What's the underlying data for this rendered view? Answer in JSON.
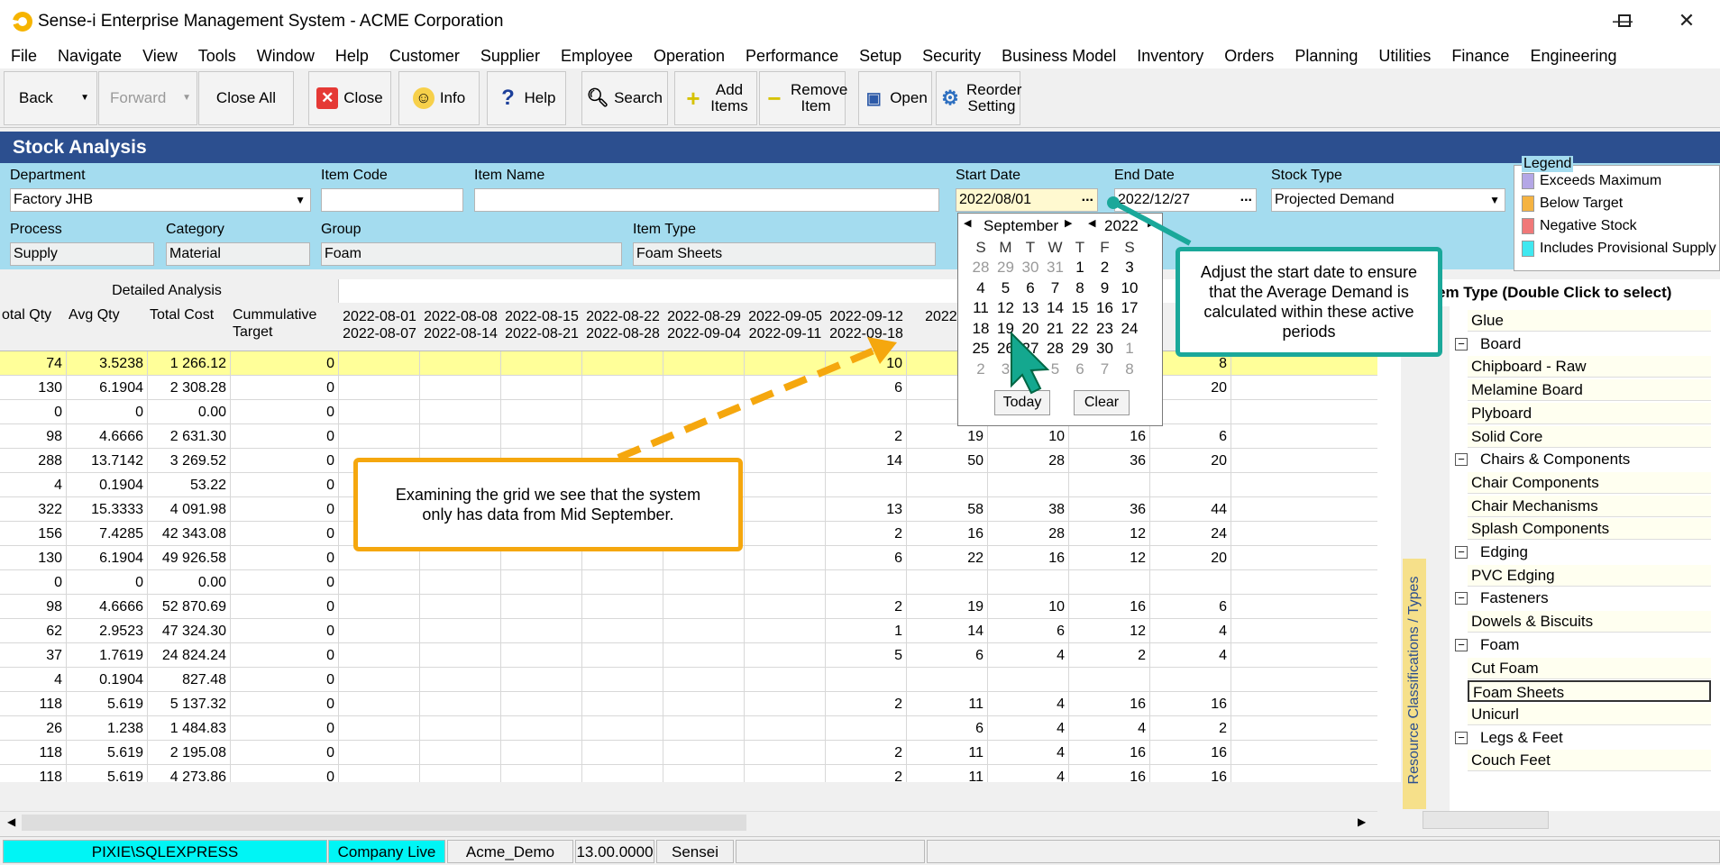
{
  "window": {
    "title": "Sense-i Enterprise Management System - ACME Corporation",
    "min": "—",
    "max": "☐",
    "close": "✕"
  },
  "menu": [
    "File",
    "Navigate",
    "View",
    "Tools",
    "Window",
    "Help",
    "Customer",
    "Supplier",
    "Employee",
    "Operation",
    "Performance",
    "Setup",
    "Security",
    "Business Model",
    "Inventory",
    "Orders",
    "Planning",
    "Utilities",
    "Finance",
    "Engineering"
  ],
  "toolbar": {
    "back": "Back",
    "forward": "Forward",
    "close_all": "Close All",
    "close": "Close",
    "info": "Info",
    "help": "Help",
    "search": "Search",
    "add_items": "Add Items",
    "remove_item": "Remove Item",
    "open": "Open",
    "reorder": "Reorder Setting"
  },
  "page": {
    "title": "Stock Analysis"
  },
  "filters": {
    "department_label": "Department",
    "department": "Factory JHB",
    "item_code_label": "Item Code",
    "item_code": "",
    "item_name_label": "Item Name",
    "item_name": "",
    "start_date_label": "Start Date",
    "start_date": "2022/08/01",
    "end_date_label": "End Date",
    "end_date": "2022/12/27",
    "stock_type_label": "Stock Type",
    "stock_type": "Projected Demand",
    "process_label": "Process",
    "process": "Supply",
    "category_label": "Category",
    "category": "Material",
    "group_label": "Group",
    "group": "Foam",
    "item_type_label": "Item Type",
    "item_type": "Foam Sheets",
    "dots": "..."
  },
  "legend": {
    "title": "Legend",
    "items": [
      {
        "label": "Exceeds Maximum",
        "color": "#b4a7e6"
      },
      {
        "label": "Below Target",
        "color": "#f5b342"
      },
      {
        "label": "Negative Stock",
        "color": "#f07878"
      },
      {
        "label": "Includes Provisional Supply",
        "color": "#40e8f0"
      }
    ]
  },
  "grid": {
    "group_header": "Detailed Analysis",
    "cols": [
      "otal Qty",
      "Avg Qty",
      "Total Cost",
      "Cummulative Target"
    ],
    "week_cols": [
      [
        "2022-08-01",
        "2022-08-07"
      ],
      [
        "2022-08-08",
        "2022-08-14"
      ],
      [
        "2022-08-15",
        "2022-08-21"
      ],
      [
        "2022-08-22",
        "2022-08-28"
      ],
      [
        "2022-08-29",
        "2022-09-04"
      ],
      [
        "2022-09-05",
        "2022-09-11"
      ],
      [
        "2022-09-12",
        "2022-09-18"
      ],
      [
        "2022-0",
        ""
      ],
      [
        "",
        ""
      ],
      [
        "",
        ""
      ],
      [
        "20",
        ""
      ]
    ],
    "rows": [
      [
        "74",
        "3.5238",
        "1 266.12",
        "0",
        "10",
        "",
        "",
        "",
        "8"
      ],
      [
        "130",
        "6.1904",
        "2 308.28",
        "0",
        "6",
        "",
        "",
        "",
        "20"
      ],
      [
        "0",
        "0",
        "0.00",
        "0",
        "",
        "",
        "",
        "",
        ""
      ],
      [
        "98",
        "4.6666",
        "2 631.30",
        "0",
        "2",
        "19",
        "10",
        "16",
        "6"
      ],
      [
        "288",
        "13.7142",
        "3 269.52",
        "0",
        "14",
        "50",
        "28",
        "36",
        "20"
      ],
      [
        "4",
        "0.1904",
        "53.22",
        "0",
        "",
        "",
        "",
        "",
        ""
      ],
      [
        "322",
        "15.3333",
        "4 091.98",
        "0",
        "13",
        "58",
        "38",
        "36",
        "44"
      ],
      [
        "156",
        "7.4285",
        "42 343.08",
        "0",
        "2",
        "16",
        "28",
        "12",
        "24"
      ],
      [
        "130",
        "6.1904",
        "49 926.58",
        "0",
        "6",
        "22",
        "16",
        "12",
        "20"
      ],
      [
        "0",
        "0",
        "0.00",
        "0",
        "",
        "",
        "",
        "",
        ""
      ],
      [
        "98",
        "4.6666",
        "52 870.69",
        "0",
        "2",
        "19",
        "10",
        "16",
        "6"
      ],
      [
        "62",
        "2.9523",
        "47 324.30",
        "0",
        "1",
        "14",
        "6",
        "12",
        "4"
      ],
      [
        "37",
        "1.7619",
        "24 824.24",
        "0",
        "5",
        "6",
        "4",
        "2",
        "4"
      ],
      [
        "4",
        "0.1904",
        "827.48",
        "0",
        "",
        "",
        "",
        "",
        ""
      ],
      [
        "118",
        "5.619",
        "5 137.32",
        "0",
        "2",
        "11",
        "4",
        "16",
        "16"
      ],
      [
        "26",
        "1.238",
        "1 484.83",
        "0",
        "",
        "6",
        "4",
        "4",
        "2"
      ],
      [
        "118",
        "5.619",
        "2 195.08",
        "0",
        "2",
        "11",
        "4",
        "16",
        "16"
      ],
      [
        "118",
        "5.619",
        "4 273.86",
        "0",
        "2",
        "11",
        "4",
        "16",
        "16"
      ]
    ]
  },
  "tree": {
    "header": "em Type (Double Click to select)",
    "side_tab": "Resource Classifications / Types",
    "items": [
      {
        "t": "Glue",
        "lvl": 1
      },
      {
        "t": "Board",
        "lvl": 0
      },
      {
        "t": "Chipboard - Raw",
        "lvl": 1
      },
      {
        "t": "Melamine Board",
        "lvl": 1
      },
      {
        "t": "Plyboard",
        "lvl": 1
      },
      {
        "t": "Solid Core",
        "lvl": 1
      },
      {
        "t": "Chairs & Components",
        "lvl": 0
      },
      {
        "t": "Chair Components",
        "lvl": 1
      },
      {
        "t": "Chair Mechanisms",
        "lvl": 1
      },
      {
        "t": "Splash Components",
        "lvl": 1
      },
      {
        "t": "Edging",
        "lvl": 0
      },
      {
        "t": "PVC Edging",
        "lvl": 1
      },
      {
        "t": "Fasteners",
        "lvl": 0
      },
      {
        "t": "Dowels & Biscuits",
        "lvl": 1
      },
      {
        "t": "Foam",
        "lvl": 0
      },
      {
        "t": "Cut Foam",
        "lvl": 1
      },
      {
        "t": "Foam Sheets",
        "lvl": 1
      },
      {
        "t": "Unicurl",
        "lvl": 1
      },
      {
        "t": "Legs & Feet",
        "lvl": 0
      },
      {
        "t": "Couch Feet",
        "lvl": 1
      }
    ]
  },
  "calendar": {
    "month": "September",
    "year": "2022",
    "days": [
      "S",
      "M",
      "T",
      "W",
      "T",
      "F",
      "S"
    ],
    "weeks": [
      [
        "28",
        "29",
        "30",
        "31",
        "1",
        "2",
        "3"
      ],
      [
        "4",
        "5",
        "6",
        "7",
        "8",
        "9",
        "10"
      ],
      [
        "11",
        "12",
        "13",
        "14",
        "15",
        "16",
        "17"
      ],
      [
        "18",
        "19",
        "20",
        "21",
        "22",
        "23",
        "24"
      ],
      [
        "25",
        "26",
        "27",
        "28",
        "29",
        "30",
        "1"
      ],
      [
        "2",
        "3",
        "4",
        "5",
        "6",
        "7",
        "8"
      ]
    ],
    "today": "Today",
    "clear": "Clear"
  },
  "callouts": {
    "grid_note": "Examining the grid we see that the system only has data from Mid September.",
    "date_note": "Adjust the start date to ensure that the Average Demand is calculated within these active periods"
  },
  "status": {
    "server": "PIXIE\\SQLEXPRESS",
    "company": "Company Live",
    "db": "Acme_Demo",
    "version": "13.00.0000",
    "user": "Sensei"
  }
}
